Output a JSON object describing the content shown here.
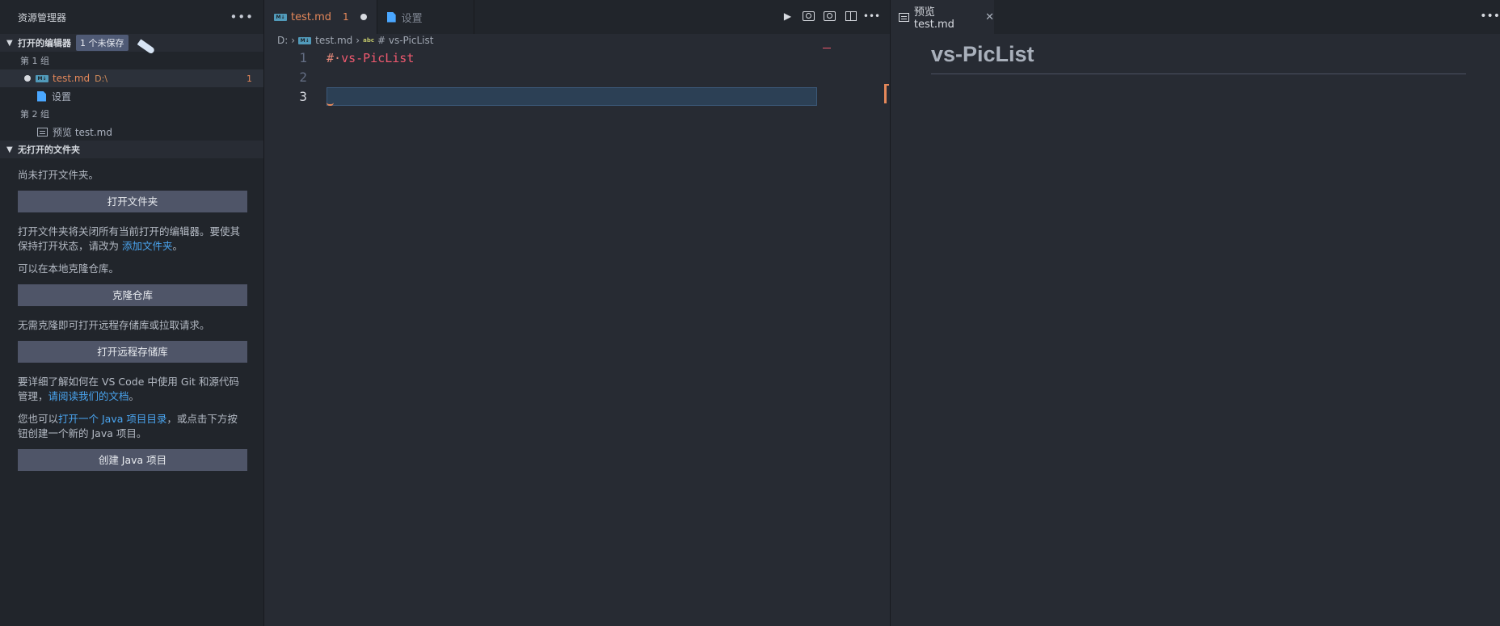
{
  "sidebar": {
    "title": "资源管理器",
    "more": "•••",
    "open_editors": {
      "header": "打开的编辑器",
      "badge": "1 个未保存",
      "group1": "第 1 组",
      "group2": "第 2 组",
      "items": [
        {
          "name": "test.md",
          "hint": "D:\\",
          "count": "1"
        },
        {
          "name": "设置"
        },
        {
          "name": "预览 test.md"
        }
      ]
    },
    "no_folder": {
      "header": "无打开的文件夹",
      "text1": "尚未打开文件夹。",
      "btn_open_folder": "打开文件夹",
      "text2_pre": "打开文件夹将关闭所有当前打开的编辑器。要使其保持打开状态，请改为 ",
      "text2_link": "添加文件夹",
      "text2_post": "。",
      "text3": "可以在本地克隆仓库。",
      "btn_clone": "克隆仓库",
      "text4": "无需克隆即可打开远程存储库或拉取请求。",
      "btn_remote": "打开远程存储库",
      "text5_pre": "要详细了解如何在 VS Code 中使用 Git 和源代码管理，",
      "text5_link": "请阅读我们的文档",
      "text5_post": "。",
      "text6_pre": "您也可以",
      "text6_link": "打开一个 Java 项目目录",
      "text6_post": "，或点击下方按钮创建一个新的 Java 项目。",
      "btn_java": "创建 Java 项目"
    }
  },
  "editor": {
    "tabs": [
      {
        "label": "test.md",
        "count": "1"
      },
      {
        "label": "设置"
      }
    ],
    "md_icon": "M↓",
    "breadcrumb": {
      "drive": "D:",
      "file": "test.md",
      "abc": "abc",
      "symbol": "# vs-PicList"
    },
    "line_numbers": [
      "1",
      "2",
      "3"
    ],
    "lines": [
      {
        "hash": "#·",
        "text": "vs-PicList"
      }
    ],
    "actions": [
      "run-icon",
      "preview-icon",
      "open-preview-icon",
      "split-icon",
      "more-icon"
    ]
  },
  "preview": {
    "tab_label": "预览 test.md",
    "close": "✕",
    "more": "•••",
    "heading": "vs-PicList"
  }
}
